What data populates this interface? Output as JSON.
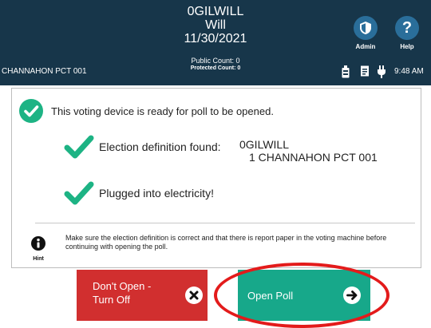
{
  "header": {
    "title": "0GILWILL",
    "county": "Will",
    "date": "11/30/2021",
    "precinct": "CHANNAHON PCT 001",
    "public_count": "Public Count: 0",
    "protected_count": "Protected Count: 0",
    "admin_label": "Admin",
    "help_label": "Help",
    "time": "9:48 AM"
  },
  "status_icons": [
    "ballot-box-icon",
    "printer-icon",
    "power-plug-icon"
  ],
  "main": {
    "ready_message": "This voting device is ready for poll to be opened.",
    "checks": [
      {
        "label": "Election definition found:"
      },
      {
        "label": "Plugged into electricity!"
      }
    ],
    "definition_values": [
      "0GILWILL",
      "1 CHANNAHON PCT 001"
    ],
    "hint_label": "Hint",
    "hint_text": "Make sure the election definition is correct and that there is report paper in the voting machine before continuing with opening the poll."
  },
  "actions": {
    "dont_open_label": "Don't Open - Turn Off",
    "open_poll_label": "Open Poll"
  },
  "colors": {
    "header_bg": "#17364a",
    "check_green": "#1db384",
    "dont_open_red": "#d12f2f",
    "open_poll_green": "#17a88a",
    "highlight_red": "#e31b1b"
  }
}
